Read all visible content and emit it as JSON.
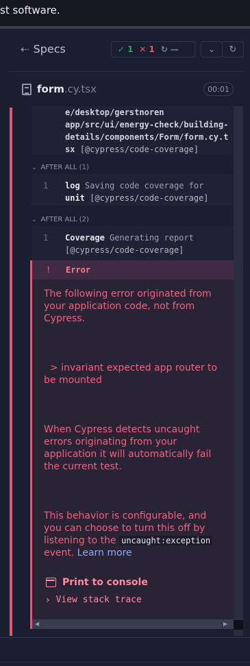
{
  "banner": {
    "text": "st software."
  },
  "header": {
    "specs_label": "Specs",
    "passed": "1",
    "failed": "1",
    "pending": "—"
  },
  "file": {
    "name": "form",
    "ext": ".cy.tsx",
    "duration": "00:01"
  },
  "log_top": {
    "lines": [
      "e/desktop/gerstnoren",
      "app/src/ui/energy-check/building-",
      "details/components/Form/form.cy.t"
    ],
    "last_line_prefix": "sx",
    "last_line_plugin": "[@cypress/code-coverage]"
  },
  "after_all_1": {
    "label": "AFTER ALL (1)",
    "num": "1",
    "keyword": "log",
    "message": "Saving code coverage for",
    "line2_bold": "unit",
    "plugin": "[@cypress/code-coverage]"
  },
  "after_all_2": {
    "label": "AFTER ALL (2)",
    "num": "1",
    "keyword": "Coverage",
    "message": "Generating report",
    "plugin": "[@cypress/code-coverage]"
  },
  "error": {
    "bang": "!",
    "title": "Error",
    "para1": "The following error originated from your application code, not from Cypress.",
    "para2": "  > invariant expected app router to be mounted",
    "para3": "When Cypress detects uncaught errors originating from your application it will automatically fail the current test.",
    "para4_a": "This behavior is configurable, and you can choose to turn this off by listening to the",
    "para4_code": "uncaught:exception",
    "para4_b": "event.",
    "learn_more": "Learn more",
    "print_console": "Print to console",
    "view_stack": "View stack trace"
  },
  "colors": {
    "fail": "#e45770",
    "pass": "#1fa971",
    "error_text": "#f1627c",
    "link": "#8aa9ff"
  }
}
